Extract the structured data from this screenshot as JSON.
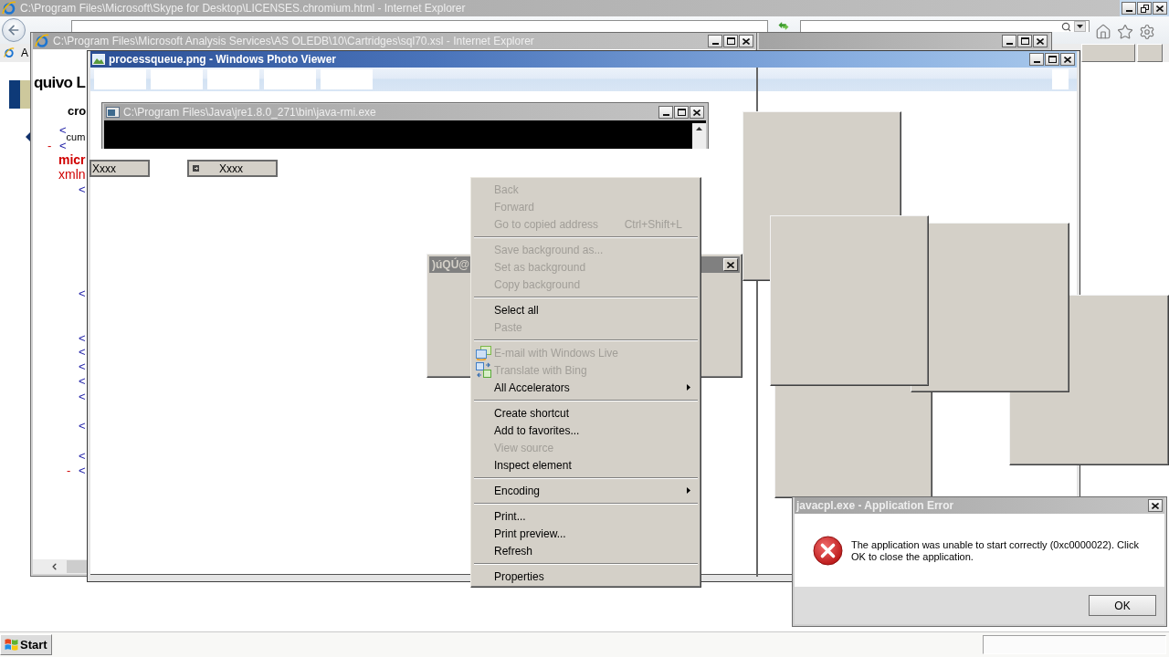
{
  "browser_window": {
    "title": "C:\\Program Files\\Microsoft\\Skype for Desktop\\LICENSES.chromium.html - Internet Explorer",
    "active": false,
    "maximized": true,
    "favorites_label": "A"
  },
  "xsl_window": {
    "title": "C:\\Program Files\\Microsoft Analysis Services\\AS OLEDB\\10\\Cartridges\\sql70.xsl - Internet Explorer",
    "active": false,
    "maximized": false,
    "page": {
      "heading": "quivo L",
      "subheading": "cro",
      "nodes": [
        {
          "tag": "<",
          "text": "cum"
        },
        {
          "marker": "-",
          "tag": "<",
          "name": "micr",
          "attribute": "xmln",
          "children": [
            {
              "tag": "<"
            },
            {
              "tag": "<"
            },
            {
              "tag": "<"
            },
            {
              "tag": "<"
            },
            {
              "tag": "<"
            },
            {
              "tag": "<"
            },
            {
              "tag": "<"
            },
            {
              "tag": "<"
            },
            {
              "tag": "<"
            },
            {
              "marker": "-",
              "tag": "<"
            }
          ]
        }
      ]
    }
  },
  "hidden_window": {
    "active": false,
    "maximized": false
  },
  "photo_viewer": {
    "title": "processqueue.png - Windows Photo Viewer",
    "active": true,
    "maximized": false
  },
  "console_window": {
    "title": "C:\\Program Files\\Java\\jre1.8.0_271\\bin\\java-rmi.exe",
    "active": false,
    "maximized": false
  },
  "floating_buttons": [
    {
      "kind": "plain",
      "label": "Xxxx"
    },
    {
      "kind": "icon",
      "label": "Xxxx"
    }
  ],
  "small_dialog": {
    "title": ")úQÚ@",
    "active": false
  },
  "context_menu": {
    "groups": [
      {
        "items": [
          {
            "label": "Back",
            "kind": "plain",
            "disabled": true,
            "submenu": false
          },
          {
            "label": "Forward",
            "kind": "plain",
            "disabled": true,
            "submenu": false
          },
          {
            "label": "Go to copied address",
            "kind": "plain",
            "disabled": true,
            "submenu": false,
            "shortcut": "Ctrl+Shift+L"
          }
        ]
      },
      {
        "items": [
          {
            "label": "Save background as...",
            "kind": "plain",
            "disabled": true,
            "submenu": false
          },
          {
            "label": "Set as background",
            "kind": "plain",
            "disabled": true,
            "submenu": false
          },
          {
            "label": "Copy background",
            "kind": "plain",
            "disabled": true,
            "submenu": false
          }
        ]
      },
      {
        "items": [
          {
            "label": "Select all",
            "kind": "plain",
            "disabled": false,
            "submenu": false
          },
          {
            "label": "Paste",
            "kind": "plain",
            "disabled": true,
            "submenu": false
          }
        ]
      },
      {
        "items": [
          {
            "label": "E-mail with Windows Live",
            "kind": "mail",
            "disabled": true,
            "submenu": false
          },
          {
            "label": "Translate with Bing",
            "kind": "translate",
            "disabled": true,
            "submenu": false
          },
          {
            "label": "All Accelerators",
            "kind": "plain",
            "disabled": false,
            "submenu": true
          }
        ]
      },
      {
        "items": [
          {
            "label": "Create shortcut",
            "kind": "plain",
            "disabled": false,
            "submenu": false
          },
          {
            "label": "Add to favorites...",
            "kind": "plain",
            "disabled": false,
            "submenu": false
          },
          {
            "label": "View source",
            "kind": "plain",
            "disabled": true,
            "submenu": false
          },
          {
            "label": "Inspect element",
            "kind": "plain",
            "disabled": false,
            "submenu": false
          }
        ]
      },
      {
        "items": [
          {
            "label": "Encoding",
            "kind": "plain",
            "disabled": false,
            "submenu": true
          }
        ]
      },
      {
        "items": [
          {
            "label": "Print...",
            "kind": "plain",
            "disabled": false,
            "submenu": false
          },
          {
            "label": "Print preview...",
            "kind": "plain",
            "disabled": false,
            "submenu": false
          },
          {
            "label": "Refresh",
            "kind": "plain",
            "disabled": false,
            "submenu": false
          }
        ]
      },
      {
        "items": [
          {
            "label": "Properties",
            "kind": "plain",
            "disabled": false,
            "submenu": false
          }
        ]
      }
    ]
  },
  "error_dialog": {
    "title": "javacpl.exe - Application Error",
    "active": false,
    "message": "The application was unable to start correctly (0xc0000022). Click OK to close the application.",
    "button": "OK"
  },
  "taskbar": {
    "start_label": "Start"
  }
}
